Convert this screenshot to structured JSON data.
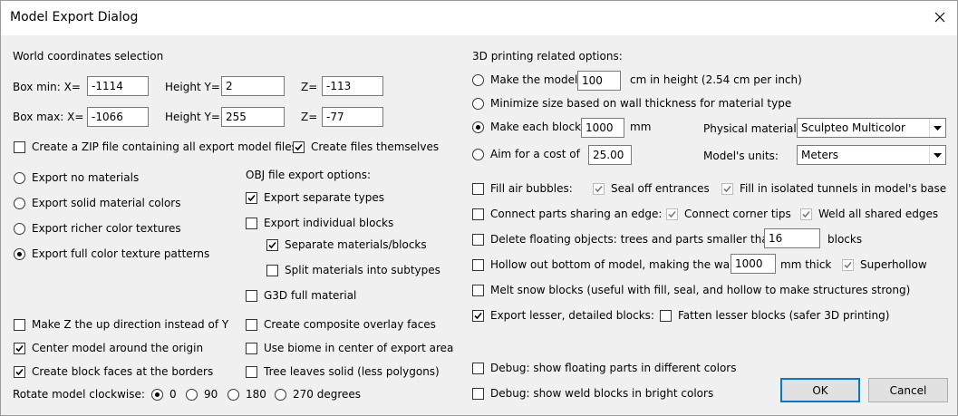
{
  "window": {
    "title": "Model Export Dialog"
  },
  "world": {
    "heading": "World coordinates selection",
    "min_label": "Box min:  X=",
    "max_label": "Box max:  X=",
    "height_label": "Height Y=",
    "z_label": "Z=",
    "min": {
      "x": "-1114",
      "y": "2",
      "z": "-113"
    },
    "max": {
      "x": "-1066",
      "y": "255",
      "z": "-77"
    }
  },
  "zip": {
    "label": "Create a ZIP file containing all export model files",
    "checked": false
  },
  "files": {
    "label": "Create files themselves",
    "checked": true
  },
  "materials": {
    "options": [
      {
        "label": "Export no materials",
        "selected": false
      },
      {
        "label": "Export solid material colors",
        "selected": false
      },
      {
        "label": "Export richer color textures",
        "selected": false
      },
      {
        "label": "Export full color texture patterns",
        "selected": true
      }
    ]
  },
  "obj": {
    "heading": "OBJ file export options:",
    "separate_types": {
      "label": "Export separate types",
      "checked": true
    },
    "individual_blocks": {
      "label": "Export individual blocks",
      "checked": false
    },
    "separate_materials": {
      "label": "Separate materials/blocks",
      "checked": true
    },
    "split_materials": {
      "label": "Split materials into subtypes",
      "checked": false
    },
    "g3d": {
      "label": "G3D full material",
      "checked": false
    }
  },
  "left_options": {
    "z_up": {
      "label": "Make Z the up direction instead of Y",
      "checked": false
    },
    "center": {
      "label": "Center model around the origin",
      "checked": true
    },
    "block_faces": {
      "label": "Create block faces at the borders",
      "checked": true
    }
  },
  "mid_options": {
    "composite": {
      "label": "Create composite overlay faces",
      "checked": false
    },
    "biome": {
      "label": "Use biome in center of export area",
      "checked": false
    },
    "tree_leaves": {
      "label": "Tree leaves solid (less polygons)",
      "checked": false
    }
  },
  "rotate": {
    "label": "Rotate model clockwise:",
    "options": [
      {
        "label": "0",
        "selected": true
      },
      {
        "label": "90",
        "selected": false
      },
      {
        "label": "180",
        "selected": false
      },
      {
        "label": "270 degrees",
        "selected": false
      }
    ]
  },
  "printing": {
    "heading": "3D printing related options:",
    "make_height": {
      "label": "Make the model",
      "value": "100",
      "suffix": "cm in height (2.54 cm per inch)",
      "selected": false
    },
    "minimize": {
      "label": "Minimize size based on wall thickness for material type",
      "selected": false
    },
    "each_block": {
      "label": "Make each block",
      "value": "1000",
      "suffix": "mm",
      "selected": true
    },
    "cost": {
      "label": "Aim for a cost of",
      "value": "25.00",
      "selected": false
    },
    "material_label": "Physical material:",
    "material_value": "Sculpteo Multicolor",
    "units_label": "Model's units:",
    "units_value": "Meters"
  },
  "fill": {
    "fill_air": {
      "label": "Fill air bubbles:",
      "checked": false
    },
    "seal": {
      "label": "Seal off entrances",
      "checked": true
    },
    "fill_tunnels": {
      "label": "Fill in isolated tunnels in model's base",
      "checked": true
    }
  },
  "connect": {
    "connect_parts": {
      "label": "Connect parts sharing an edge:",
      "checked": false
    },
    "corner_tips": {
      "label": "Connect corner tips",
      "checked": true
    },
    "weld": {
      "label": "Weld all shared edges",
      "checked": true
    }
  },
  "delete_floating": {
    "label": "Delete floating objects: trees and parts smaller than",
    "value": "16",
    "suffix": "blocks",
    "checked": false
  },
  "hollow": {
    "label": "Hollow out bottom of model, making the walls",
    "value": "1000",
    "suffix": "mm thick",
    "checked": false
  },
  "superhollow": {
    "label": "Superhollow",
    "checked": true
  },
  "melt": {
    "label": "Melt snow blocks (useful with fill, seal, and hollow to make structures strong)",
    "checked": false
  },
  "lesser": {
    "label": "Export lesser, detailed blocks:",
    "checked": true
  },
  "fatten": {
    "label": "Fatten lesser blocks (safer 3D printing)",
    "checked": false
  },
  "debug": {
    "floating": {
      "label": "Debug: show floating parts in different colors",
      "checked": false
    },
    "weld": {
      "label": "Debug: show weld blocks in bright colors",
      "checked": false
    }
  },
  "buttons": {
    "ok": "OK",
    "cancel": "Cancel"
  }
}
